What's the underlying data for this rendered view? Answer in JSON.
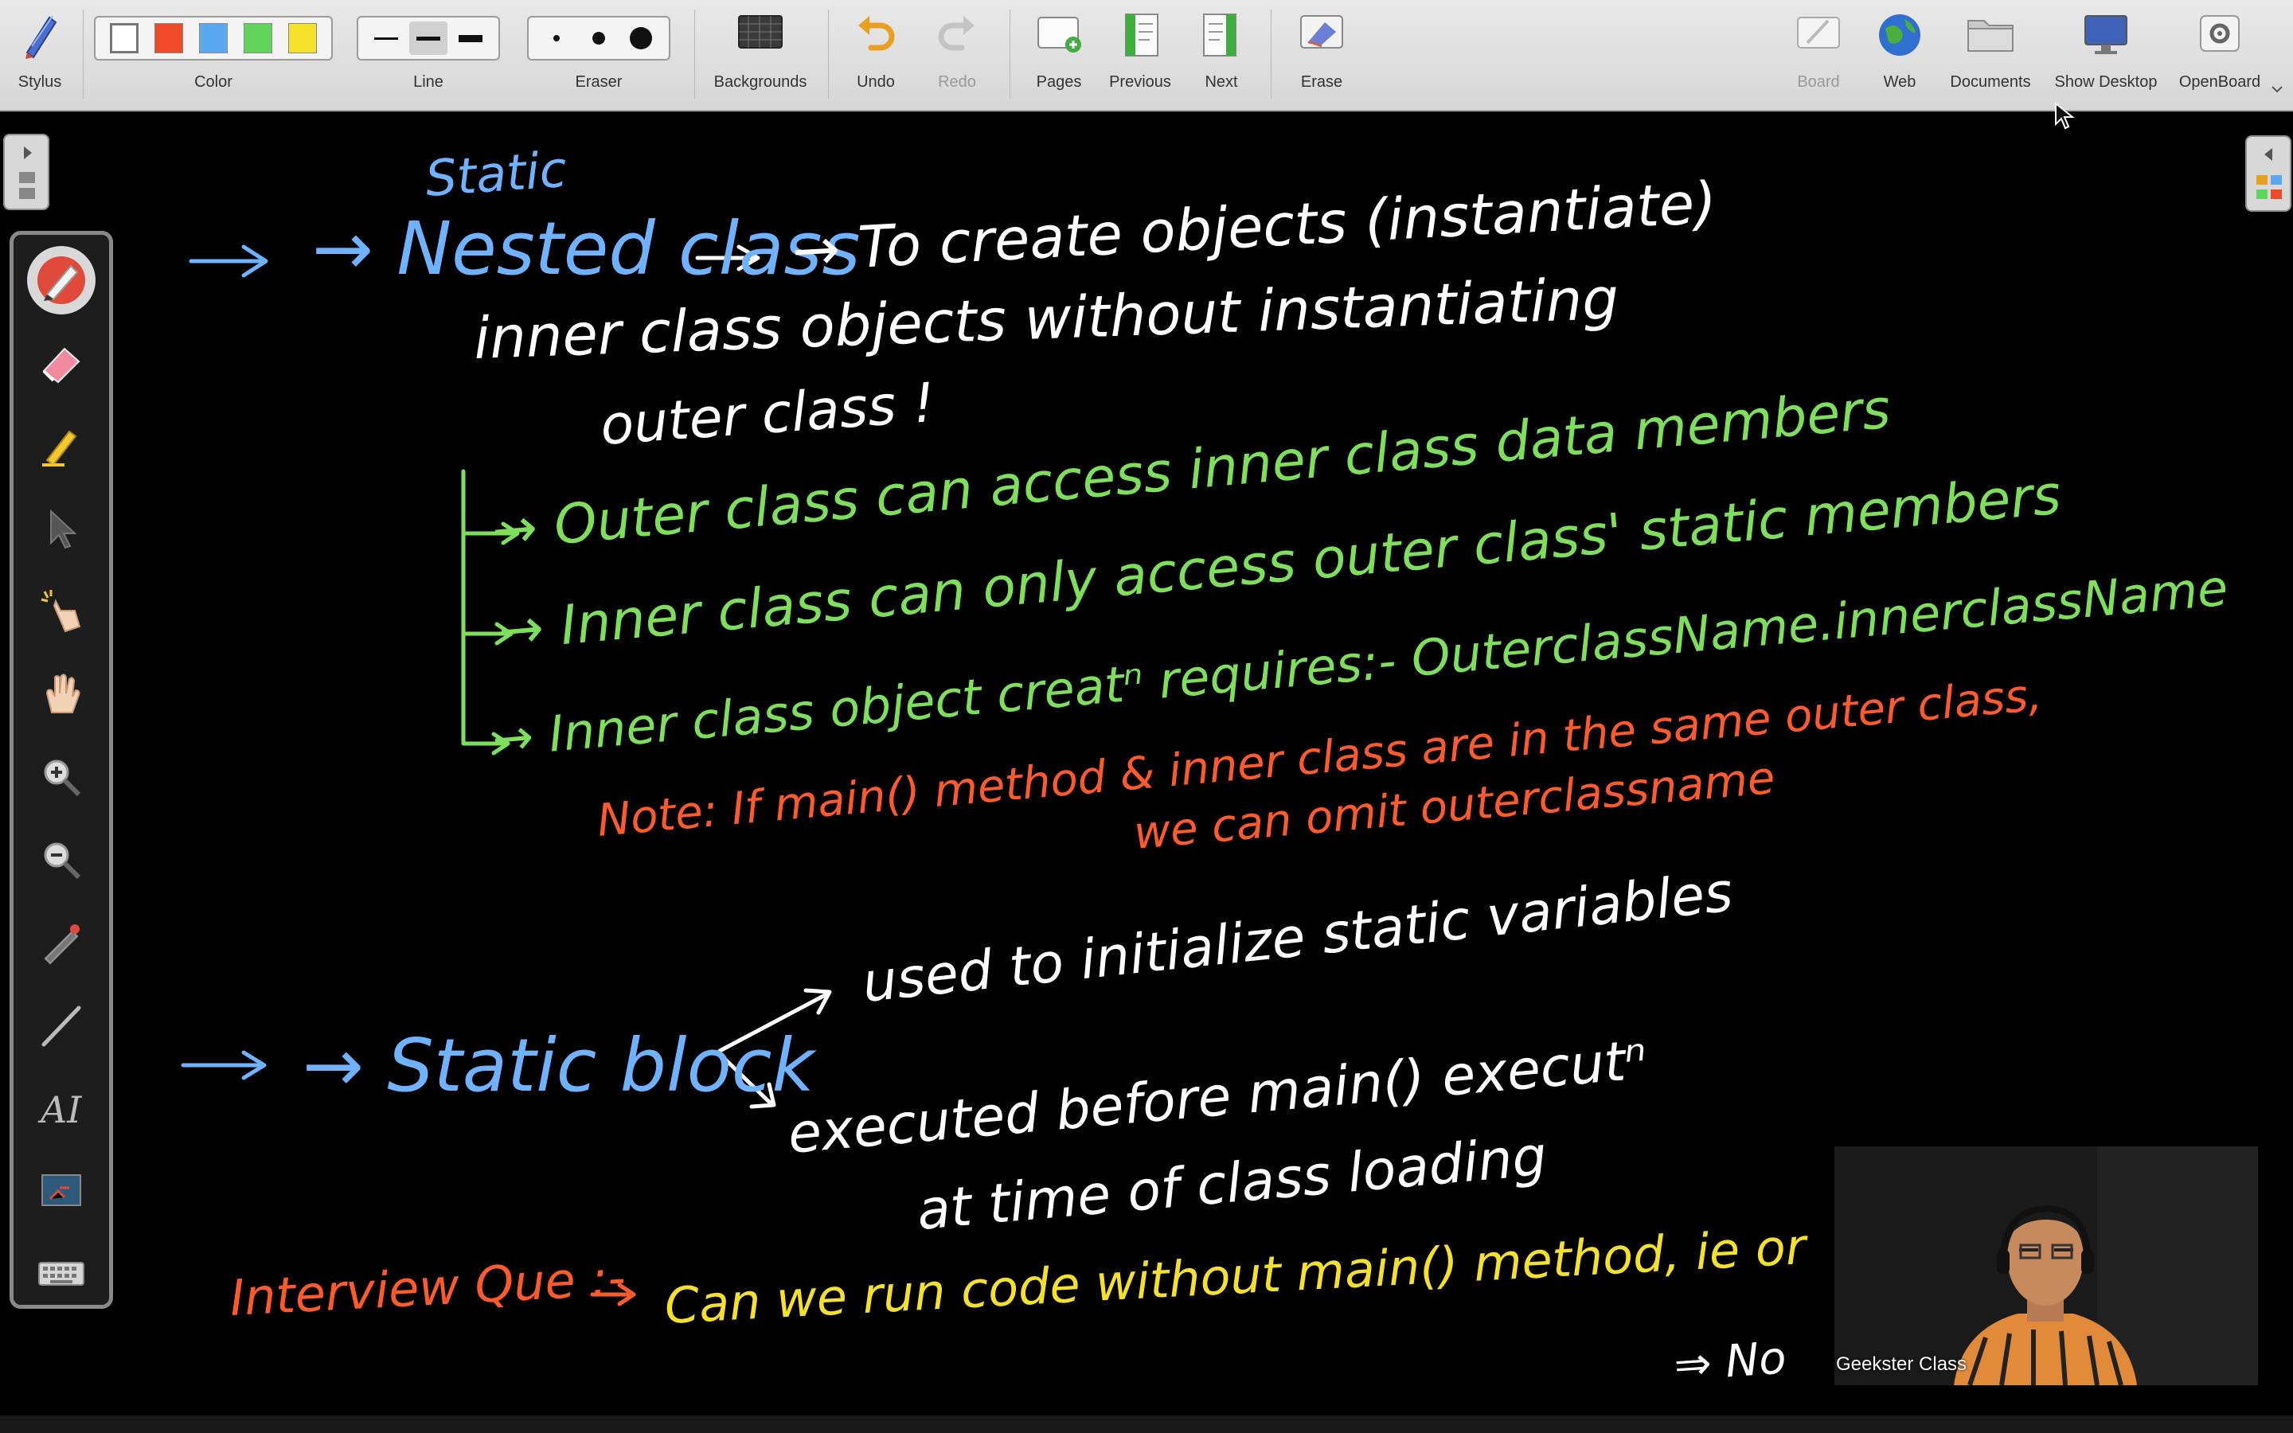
{
  "toolbar": {
    "stylus_label": "Stylus",
    "color_label": "Color",
    "line_label": "Line",
    "eraser_label": "Eraser",
    "backgrounds_label": "Backgrounds",
    "undo_label": "Undo",
    "redo_label": "Redo",
    "pages_label": "Pages",
    "previous_label": "Previous",
    "next_label": "Next",
    "erase_label": "Erase",
    "board_label": "Board",
    "web_label": "Web",
    "documents_label": "Documents",
    "show_desktop_label": "Show Desktop",
    "openboard_label": "OpenBoard",
    "colors": [
      "#ffffff",
      "#f04a2a",
      "#5aa8f0",
      "#5fd35a",
      "#f5e12a"
    ]
  },
  "board": {
    "background": "#000000",
    "lines": [
      {
        "text": "Static",
        "color": "#6fb2ff"
      },
      {
        "text": "→ Nested class",
        "color": "#6fb2ff"
      },
      {
        "text": "→ To create objects (instantiate)",
        "color": "#ffffff"
      },
      {
        "text": "inner class objects without instantiating",
        "color": "#ffffff"
      },
      {
        "text": "outer class !",
        "color": "#ffffff"
      },
      {
        "text": "→ Outer class can access inner class data members",
        "color": "#7ee05a"
      },
      {
        "text": "→ Inner class can only access outer class' static members",
        "color": "#7ee05a"
      },
      {
        "text": "→ Inner class object creatⁿ requires:- OuterclassName.innerclassName",
        "color": "#7ee05a"
      },
      {
        "text": "Note: If main() method & inner class are in the same outer class,",
        "color": "#ff5b2a"
      },
      {
        "text": "we can omit outerclassname",
        "color": "#ff5b2a"
      },
      {
        "text": "used to initialize static variables",
        "color": "#ffffff"
      },
      {
        "text": "→ Static block",
        "color": "#6fb2ff"
      },
      {
        "text": "executed before main() executⁿ",
        "color": "#ffffff"
      },
      {
        "text": "at time of class loading",
        "color": "#ffffff"
      },
      {
        "text": "Interview Que :-",
        "color": "#ff5b2a"
      },
      {
        "text": "Can we run code without main() method, ie or",
        "color": "#f5e12a"
      },
      {
        "text": "⇒ No",
        "color": "#ffffff"
      }
    ]
  },
  "webcam": {
    "name": "Geekster Class"
  }
}
